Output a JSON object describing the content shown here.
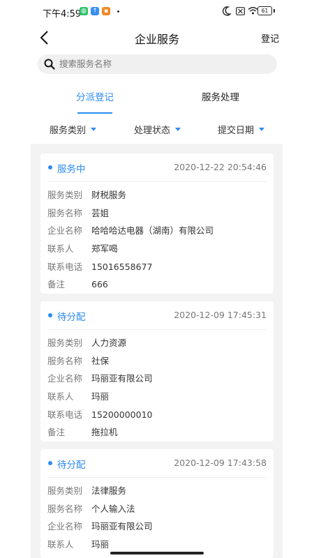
{
  "status_bar": {
    "time": "下午4:59",
    "battery": "61"
  },
  "nav": {
    "title": "企业服务",
    "action": "登记"
  },
  "search": {
    "placeholder": "搜索服务名称"
  },
  "tabs": [
    {
      "label": "分派登记",
      "active": true
    },
    {
      "label": "服务处理",
      "active": false
    }
  ],
  "filters": [
    {
      "label": "服务类别"
    },
    {
      "label": "处理状态"
    },
    {
      "label": "提交日期"
    }
  ],
  "field_labels": {
    "category": "服务类别",
    "name": "服务名称",
    "company": "企业名称",
    "contact": "联系人",
    "phone": "联系电话",
    "note": "备注"
  },
  "cards": [
    {
      "status": "服务中",
      "time": "2020-12-22 20:54:46",
      "category": "财税服务",
      "name": "芸姐",
      "company": "哈哈哈达电器（湖南）有限公司",
      "contact": "郑军喝",
      "phone": "15016558677",
      "note": "666"
    },
    {
      "status": "待分配",
      "time": "2020-12-09 17:45:31",
      "category": "人力资源",
      "name": "社保",
      "company": "玛丽亚有限公司",
      "contact": "玛丽",
      "phone": "15200000010",
      "note": "拖拉机"
    },
    {
      "status": "待分配",
      "time": "2020-12-09 17:43:58",
      "category": "法律服务",
      "name": "个人输入法",
      "company": "玛丽亚有限公司",
      "contact": "玛丽"
    }
  ],
  "colors": {
    "accent": "#2d8cf0"
  }
}
